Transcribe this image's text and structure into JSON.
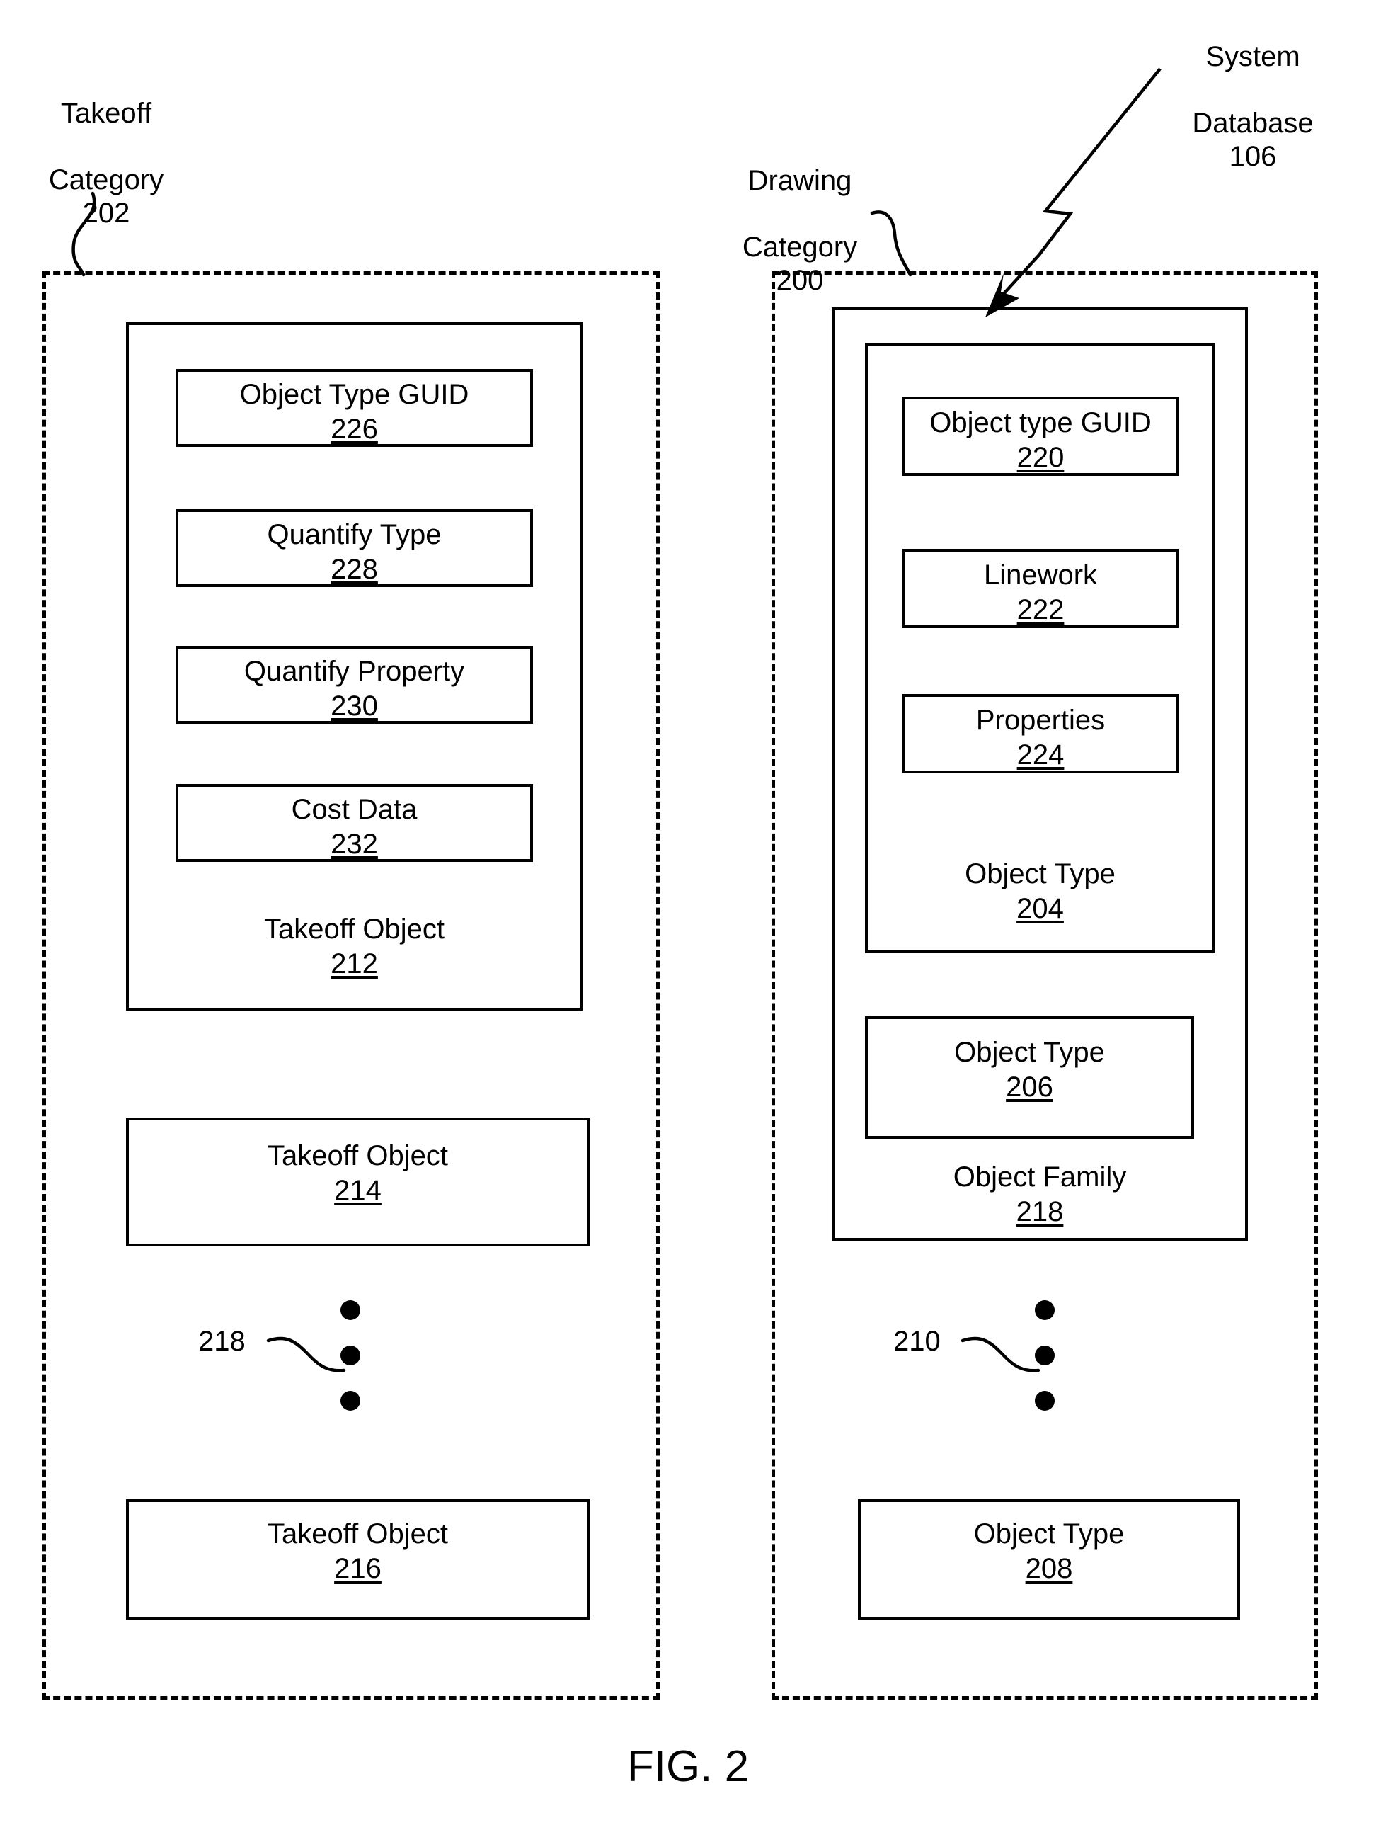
{
  "figure": {
    "caption": "FIG. 2"
  },
  "callouts": {
    "takeoff_category": {
      "line1": "Takeoff",
      "line2": "Category",
      "ref": "202"
    },
    "drawing_category": {
      "line1": "Drawing",
      "line2": "Category",
      "ref": "200"
    },
    "system_database": {
      "line1": "System",
      "line2": "Database",
      "ref": "106"
    }
  },
  "left_region": {
    "name": "Takeoff Category",
    "ref": "202",
    "takeoff_object_212": {
      "label": "Takeoff Object",
      "ref": "212",
      "fields": [
        {
          "label": "Object Type GUID",
          "ref": "226"
        },
        {
          "label": "Quantify Type",
          "ref": "228"
        },
        {
          "label": "Quantify Property",
          "ref": "230"
        },
        {
          "label": "Cost Data",
          "ref": "232"
        }
      ]
    },
    "takeoff_object_214": {
      "label": "Takeoff Object",
      "ref": "214"
    },
    "ellipsis": {
      "ref": "218",
      "dot_count": 3
    },
    "takeoff_object_216": {
      "label": "Takeoff Object",
      "ref": "216"
    }
  },
  "right_region": {
    "name": "Drawing Category",
    "ref": "200",
    "object_family_218": {
      "label": "Object Family",
      "ref": "218",
      "object_type_204": {
        "label": "Object Type",
        "ref": "204",
        "fields": [
          {
            "label": "Object type GUID",
            "ref": "220"
          },
          {
            "label": "Linework",
            "ref": "222"
          },
          {
            "label": "Properties",
            "ref": "224"
          }
        ]
      },
      "object_type_206": {
        "label": "Object Type",
        "ref": "206"
      }
    },
    "ellipsis": {
      "ref": "210",
      "dot_count": 3
    },
    "object_type_208": {
      "label": "Object Type",
      "ref": "208"
    }
  },
  "colors": {
    "ink": "#000000",
    "paper": "#ffffff"
  }
}
